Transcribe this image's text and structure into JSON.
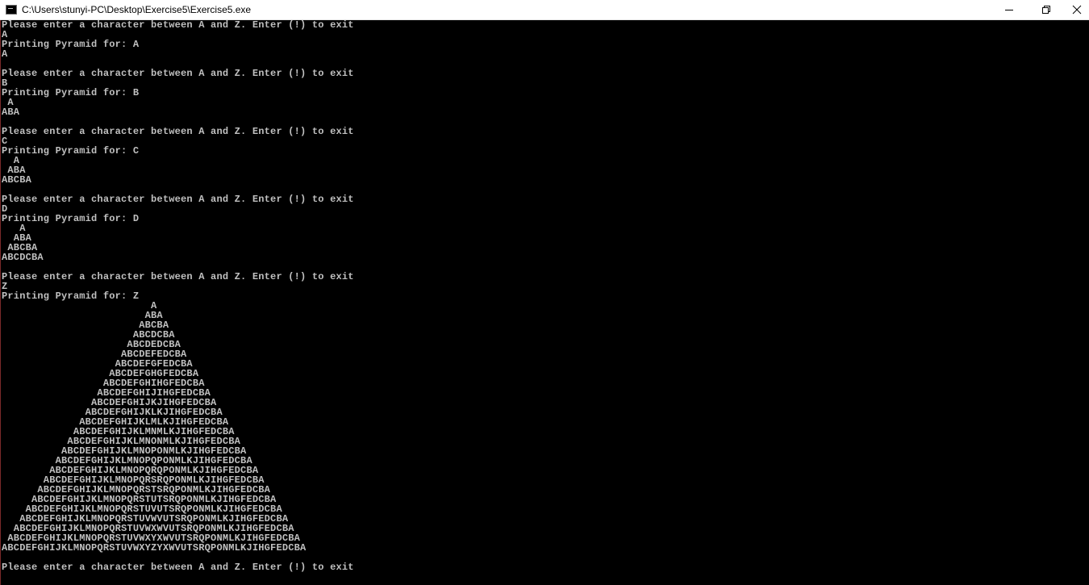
{
  "window": {
    "title": "C:\\Users\\stunyi-PC\\Desktop\\Exercise5\\Exercise5.exe",
    "icon": "console-app-icon",
    "controls": [
      "minimize-icon",
      "restore-icon",
      "close-icon"
    ],
    "colors": {
      "titlebar_bg": "#ffffff",
      "console_bg": "#000000",
      "console_text": "#c0c0c0"
    }
  },
  "console": {
    "lines": [
      "Please enter a character between A and Z. Enter (!) to exit",
      "A",
      "Printing Pyramid for: A",
      "A",
      "",
      "Please enter a character between A and Z. Enter (!) to exit",
      "B",
      "Printing Pyramid for: B",
      " A",
      "ABA",
      "",
      "Please enter a character between A and Z. Enter (!) to exit",
      "C",
      "Printing Pyramid for: C",
      "  A",
      " ABA",
      "ABCBA",
      "",
      "Please enter a character between A and Z. Enter (!) to exit",
      "D",
      "Printing Pyramid for: D",
      "   A",
      "  ABA",
      " ABCBA",
      "ABCDCBA",
      "",
      "Please enter a character between A and Z. Enter (!) to exit",
      "Z",
      "Printing Pyramid for: Z",
      "                         A",
      "                        ABA",
      "                       ABCBA",
      "                      ABCDCBA",
      "                     ABCDEDCBA",
      "                    ABCDEFEDCBA",
      "                   ABCDEFGFEDCBA",
      "                  ABCDEFGHGFEDCBA",
      "                 ABCDEFGHIHGFEDCBA",
      "                ABCDEFGHIJIHGFEDCBA",
      "               ABCDEFGHIJKJIHGFEDCBA",
      "              ABCDEFGHIJKLKJIHGFEDCBA",
      "             ABCDEFGHIJKLMLKJIHGFEDCBA",
      "            ABCDEFGHIJKLMNMLKJIHGFEDCBA",
      "           ABCDEFGHIJKLMNONMLKJIHGFEDCBA",
      "          ABCDEFGHIJKLMNOPONMLKJIHGFEDCBA",
      "         ABCDEFGHIJKLMNOPQPONMLKJIHGFEDCBA",
      "        ABCDEFGHIJKLMNOPQRQPONMLKJIHGFEDCBA",
      "       ABCDEFGHIJKLMNOPQRSRQPONMLKJIHGFEDCBA",
      "      ABCDEFGHIJKLMNOPQRSTSRQPONMLKJIHGFEDCBA",
      "     ABCDEFGHIJKLMNOPQRSTUTSRQPONMLKJIHGFEDCBA",
      "    ABCDEFGHIJKLMNOPQRSTUVUTSRQPONMLKJIHGFEDCBA",
      "   ABCDEFGHIJKLMNOPQRSTUVWVUTSRQPONMLKJIHGFEDCBA",
      "  ABCDEFGHIJKLMNOPQRSTUVWXWVUTSRQPONMLKJIHGFEDCBA",
      " ABCDEFGHIJKLMNOPQRSTUVWXYXWVUTSRQPONMLKJIHGFEDCBA",
      "ABCDEFGHIJKLMNOPQRSTUVWXYZYXWVUTSRQPONMLKJIHGFEDCBA",
      "",
      "Please enter a character between A and Z. Enter (!) to exit"
    ]
  }
}
